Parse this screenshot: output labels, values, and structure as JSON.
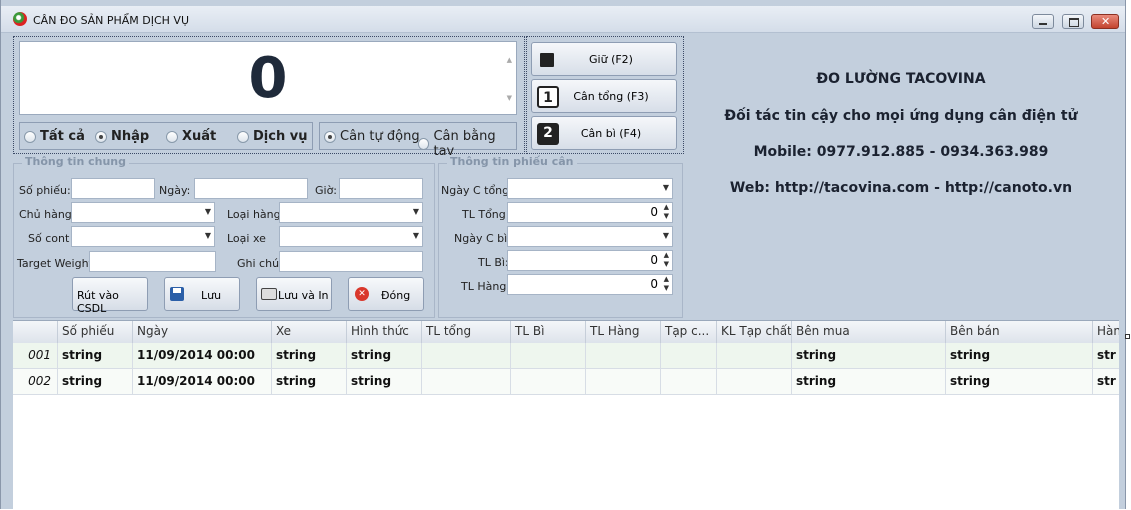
{
  "window": {
    "title": "CÂN ĐO SẢN PHẨM DỊCH VỤ"
  },
  "display": {
    "value": "0"
  },
  "modes": [
    "Tất cả",
    "Nhập",
    "Xuất",
    "Dịch vụ"
  ],
  "selected_mode": "Nhập",
  "weigh_modes": [
    "Cân tự động",
    "Cân bằng tay"
  ],
  "selected_weigh_mode": "Cân tự động",
  "actions": {
    "hold": {
      "label": "Giữ (F2)"
    },
    "gross": {
      "label": "Cân tổng (F3)",
      "key": "1"
    },
    "tare": {
      "label": "Cân bì (F4)",
      "key": "2"
    }
  },
  "company": {
    "name": "ĐO LƯỜNG TACOVINA",
    "slogan": "Đối tác tin cậy cho mọi ứng dụng cân điện tử",
    "mobile": "Mobile: 0977.912.885 - 0934.363.989",
    "web": "Web: http://tacovina.com - http://canoto.vn"
  },
  "general": {
    "legend": "Thông tin chung",
    "ticket_label": "Số phiếu:",
    "date_label": "Ngày:",
    "time_label": "Giờ:",
    "owner_label": "Chủ hàng",
    "goods_type_label": "Loại hàng",
    "cont_label": "Số cont",
    "vehicle_type_label": "Loại xe",
    "target_weight_label": "Target Weight",
    "note_label": "Ghi chú"
  },
  "ticket": {
    "legend": "Thông tin phiếu cân",
    "gross_date_label": "Ngày C tổng:",
    "gross_weight_label": "TL Tổng:",
    "gross_weight_value": "0",
    "tare_date_label": "Ngày C bì:",
    "tare_weight_label": "TL Bì:",
    "tare_weight_value": "0",
    "net_weight_label": "TL Hàng:",
    "net_weight_value": "0"
  },
  "buttons": {
    "db_withdraw": "Rút vào CSDL",
    "save": "Lưu",
    "save_print": "Lưu và In",
    "close": "Đóng"
  },
  "grid": {
    "columns": [
      "",
      "Số phiếu",
      "Ngày",
      "Xe",
      "Hình thức",
      "TL tổng",
      "TL Bì",
      "TL Hàng",
      "Tạp c...",
      "KL Tạp chất",
      "Bên mua",
      "Bên bán",
      "Hàn"
    ],
    "rows": [
      [
        "001",
        "string",
        "11/09/2014 00:00",
        "string",
        "string",
        "",
        "",
        "",
        "",
        "",
        "string",
        "string",
        "str"
      ],
      [
        "002",
        "string",
        "11/09/2014 00:00",
        "string",
        "string",
        "",
        "",
        "",
        "",
        "",
        "string",
        "string",
        "str"
      ]
    ]
  },
  "colors": {
    "window_bg": "#c3cfdd",
    "selected_row": "#eef6ee"
  }
}
